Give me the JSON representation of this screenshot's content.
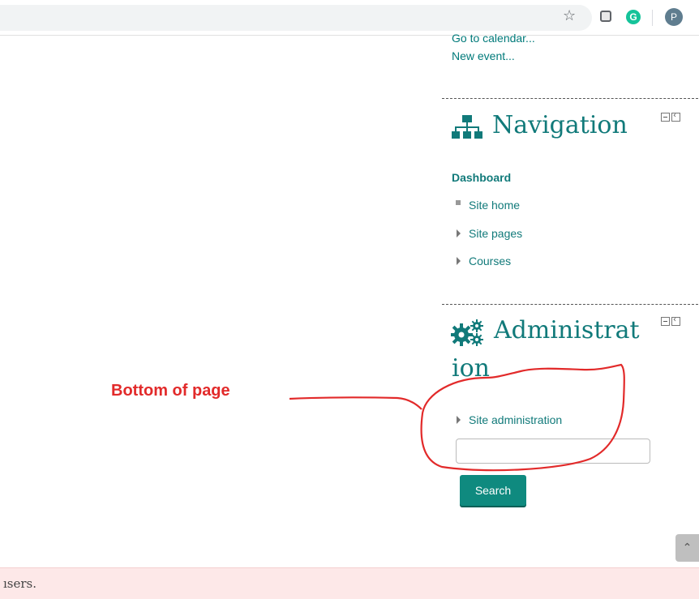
{
  "browser": {
    "star_icon": "star-icon",
    "profile_initial": "P",
    "grammarly_letter": "G"
  },
  "calendar": {
    "goto_label": "Go to calendar...",
    "new_event_label": "New event..."
  },
  "navigation": {
    "title": "Navigation",
    "dashboard": "Dashboard",
    "items": [
      {
        "label": "Site home",
        "icon": "bullet"
      },
      {
        "label": "Site pages",
        "icon": "triangle"
      },
      {
        "label": "Courses",
        "icon": "triangle"
      }
    ]
  },
  "administration": {
    "title_line1": "Administrat",
    "title_line2": "ion",
    "site_admin_label": "Site administration",
    "search_value": "",
    "search_button": "Search"
  },
  "annotation": {
    "label": "Bottom of page",
    "color": "#e22a2a"
  },
  "alert": {
    "text": "ısers."
  },
  "colors": {
    "accent": "#117a7a",
    "button": "#0f8a7f",
    "alert_bg": "#fde8e8"
  }
}
